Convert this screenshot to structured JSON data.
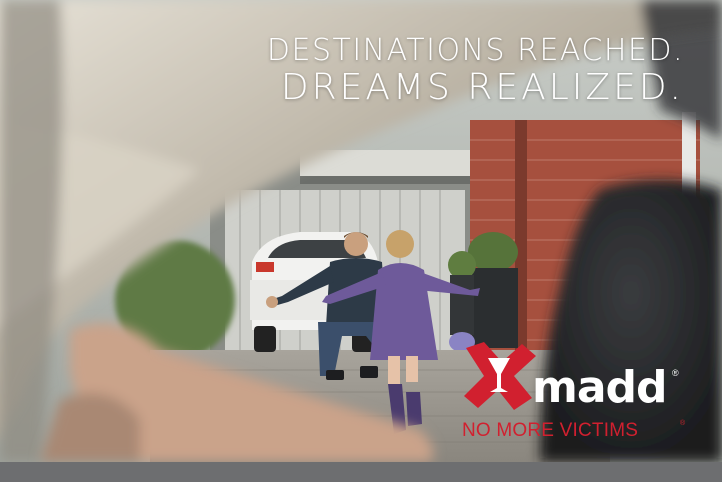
{
  "headline": {
    "line1": "DESTINATIONS REACHED.",
    "line2": "DREAMS REALIZED."
  },
  "brand": {
    "name": "madd",
    "registered_mark": "®",
    "tagline": "NO MORE VICTIMS",
    "tagline_mark": "®",
    "accent_color": "#d1202f"
  },
  "scene": {
    "description_icons": [
      "car-window-frame-icon",
      "driver-arm-icon",
      "child-running-icon",
      "father-kneeling-icon",
      "white-car-icon",
      "brick-house-icon"
    ]
  }
}
